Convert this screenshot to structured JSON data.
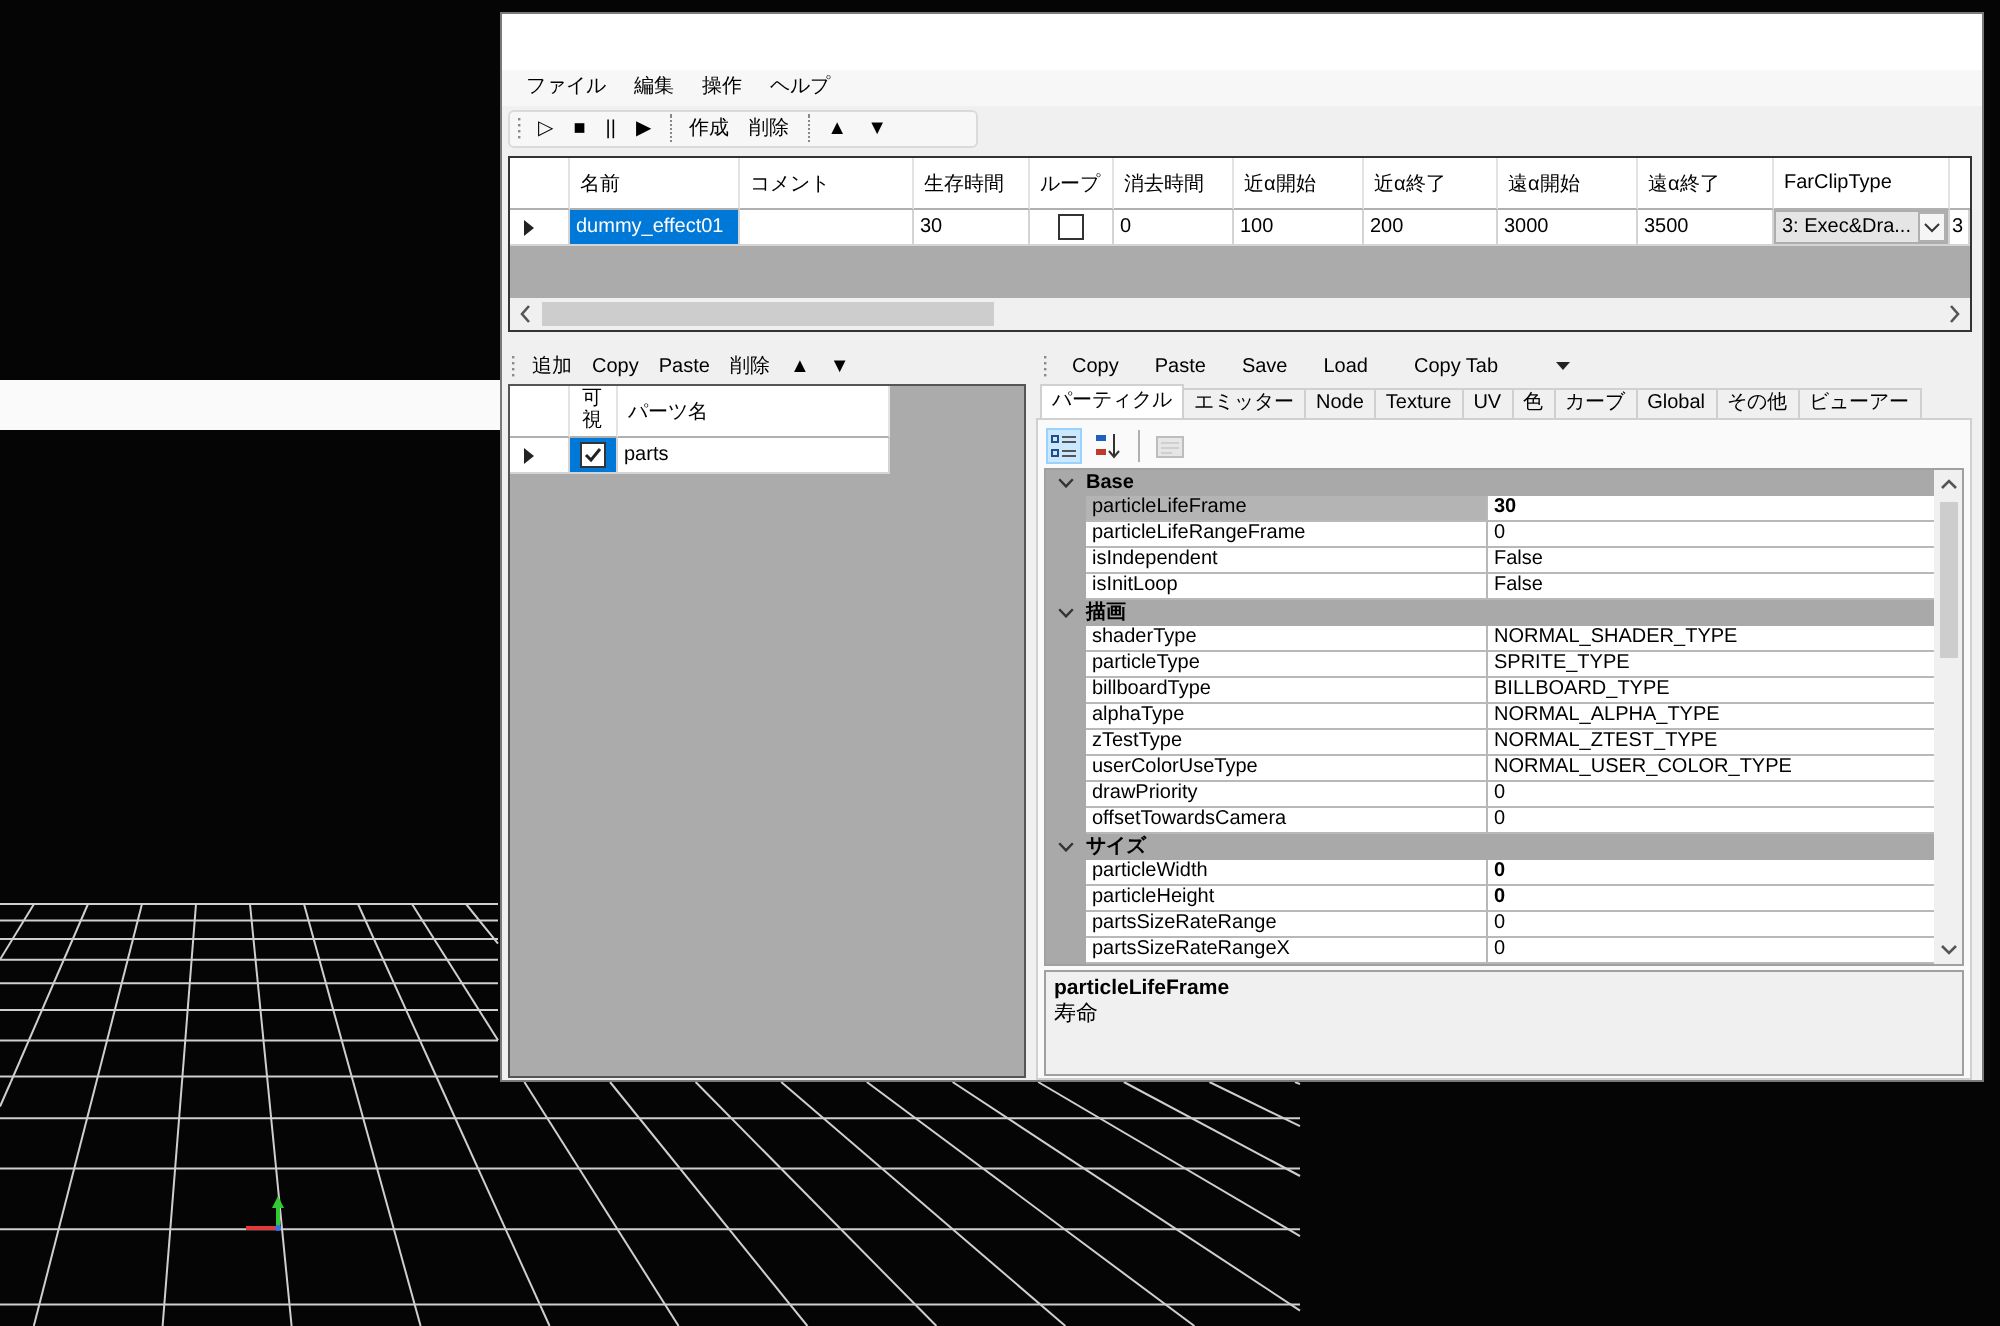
{
  "menu": [
    {
      "label": "ファイル"
    },
    {
      "label": "編集"
    },
    {
      "label": "操作"
    },
    {
      "label": "ヘルプ"
    }
  ],
  "toolbar": [
    {
      "kind": "button",
      "label": "▷"
    },
    {
      "kind": "button",
      "label": "■"
    },
    {
      "kind": "button",
      "label": "||"
    },
    {
      "kind": "button",
      "label": "▶"
    },
    {
      "kind": "separator"
    },
    {
      "kind": "button",
      "label": "作成"
    },
    {
      "kind": "button",
      "label": "削除"
    },
    {
      "kind": "separator"
    },
    {
      "kind": "button",
      "label": "▲"
    },
    {
      "kind": "button",
      "label": "▼"
    }
  ],
  "effects_grid": {
    "columns": [
      {
        "label": "名前"
      },
      {
        "label": "コメント"
      },
      {
        "label": "生存時間"
      },
      {
        "label": "ループ"
      },
      {
        "label": "消去時間"
      },
      {
        "label": "近α開始"
      },
      {
        "label": "近α終了"
      },
      {
        "label": "遠α開始"
      },
      {
        "label": "遠α終了"
      },
      {
        "label": "FarClipType"
      }
    ],
    "rows": [
      {
        "current": true,
        "cells": [
          {
            "kind": "text",
            "value": "dummy_effect01",
            "selected": true
          },
          {
            "kind": "text",
            "selected": false
          },
          {
            "kind": "text",
            "value": "30",
            "selected": false
          },
          {
            "kind": "checkbox",
            "checked": false,
            "selected": false
          },
          {
            "kind": "text",
            "value": "0",
            "selected": false
          },
          {
            "kind": "text",
            "value": "100",
            "selected": false
          },
          {
            "kind": "text",
            "value": "200",
            "selected": false
          },
          {
            "kind": "text",
            "value": "3000",
            "selected": false
          },
          {
            "kind": "text",
            "value": "3500",
            "selected": false
          },
          {
            "kind": "combo",
            "value": "3: Exec&Dra...",
            "selected": false
          },
          {
            "kind": "text",
            "value": "3",
            "selected": false
          }
        ]
      }
    ]
  },
  "parts_toolbar": [
    {
      "kind": "button",
      "label": "追加"
    },
    {
      "kind": "button",
      "label": "Copy"
    },
    {
      "kind": "button",
      "label": "Paste"
    },
    {
      "kind": "button",
      "label": "削除"
    },
    {
      "kind": "button",
      "label": "▲"
    },
    {
      "kind": "button",
      "label": "▼"
    }
  ],
  "parts_grid": {
    "columns": [
      {
        "label": "可視"
      },
      {
        "label": "パーツ名"
      }
    ],
    "rows": [
      {
        "current": true,
        "cells": [
          {
            "kind": "checkbox",
            "checked": true,
            "selected": true
          },
          {
            "kind": "text",
            "value": "parts",
            "selected": false
          }
        ]
      }
    ]
  },
  "panel_toolbar": [
    {
      "kind": "button",
      "label": "Copy"
    },
    {
      "kind": "button",
      "label": "Paste"
    },
    {
      "kind": "button",
      "label": "Save"
    },
    {
      "kind": "button",
      "label": "Load"
    },
    {
      "kind": "combo",
      "label": "Copy Tab"
    }
  ],
  "tabs": [
    {
      "label": "パーティクル",
      "selected": true
    },
    {
      "label": "エミッター",
      "selected": false
    },
    {
      "label": "Node",
      "selected": false
    },
    {
      "label": "Texture",
      "selected": false
    },
    {
      "label": "UV",
      "selected": false
    },
    {
      "label": "色",
      "selected": false
    },
    {
      "label": "カーブ",
      "selected": false
    },
    {
      "label": "Global",
      "selected": false
    },
    {
      "label": "その他",
      "selected": false
    },
    {
      "label": "ビューアー",
      "selected": false
    }
  ],
  "property_tools": [
    {
      "kind": "categorized",
      "selected": true,
      "disabled": false
    },
    {
      "kind": "alphabetical",
      "selected": false,
      "disabled": false
    },
    {
      "kind": "separator"
    },
    {
      "kind": "pages",
      "selected": false,
      "disabled": true
    }
  ],
  "property_grid": {
    "categories": [
      {
        "name": "Base",
        "expanded": true,
        "properties": [
          {
            "name": "particleLifeFrame",
            "value": "30",
            "modified": true,
            "selected": true
          },
          {
            "name": "particleLifeRangeFrame",
            "value": "0",
            "modified": false,
            "selected": false
          },
          {
            "name": "isIndependent",
            "value": "False",
            "modified": false,
            "selected": false
          },
          {
            "name": "isInitLoop",
            "value": "False",
            "modified": false,
            "selected": false
          }
        ]
      },
      {
        "name": "描画",
        "expanded": true,
        "properties": [
          {
            "name": "shaderType",
            "value": "NORMAL_SHADER_TYPE",
            "modified": false,
            "selected": false
          },
          {
            "name": "particleType",
            "value": "SPRITE_TYPE",
            "modified": false,
            "selected": false
          },
          {
            "name": "billboardType",
            "value": "BILLBOARD_TYPE",
            "modified": false,
            "selected": false
          },
          {
            "name": "alphaType",
            "value": "NORMAL_ALPHA_TYPE",
            "modified": false,
            "selected": false
          },
          {
            "name": "zTestType",
            "value": "NORMAL_ZTEST_TYPE",
            "modified": false,
            "selected": false
          },
          {
            "name": "userColorUseType",
            "value": "NORMAL_USER_COLOR_TYPE",
            "modified": false,
            "selected": false
          },
          {
            "name": "drawPriority",
            "value": "0",
            "modified": false,
            "selected": false
          },
          {
            "name": "offsetTowardsCamera",
            "value": "0",
            "modified": false,
            "selected": false
          }
        ]
      },
      {
        "name": "サイズ",
        "expanded": true,
        "properties": [
          {
            "name": "particleWidth",
            "value": "0",
            "modified": true,
            "selected": false
          },
          {
            "name": "particleHeight",
            "value": "0",
            "modified": true,
            "selected": false
          },
          {
            "name": "partsSizeRateRange",
            "value": "0",
            "modified": false,
            "selected": false
          },
          {
            "name": "partsSizeRateRangeX",
            "value": "0",
            "modified": false,
            "selected": false
          }
        ]
      }
    ]
  },
  "description": {
    "title": "particleLifeFrame",
    "text": "寿命"
  }
}
